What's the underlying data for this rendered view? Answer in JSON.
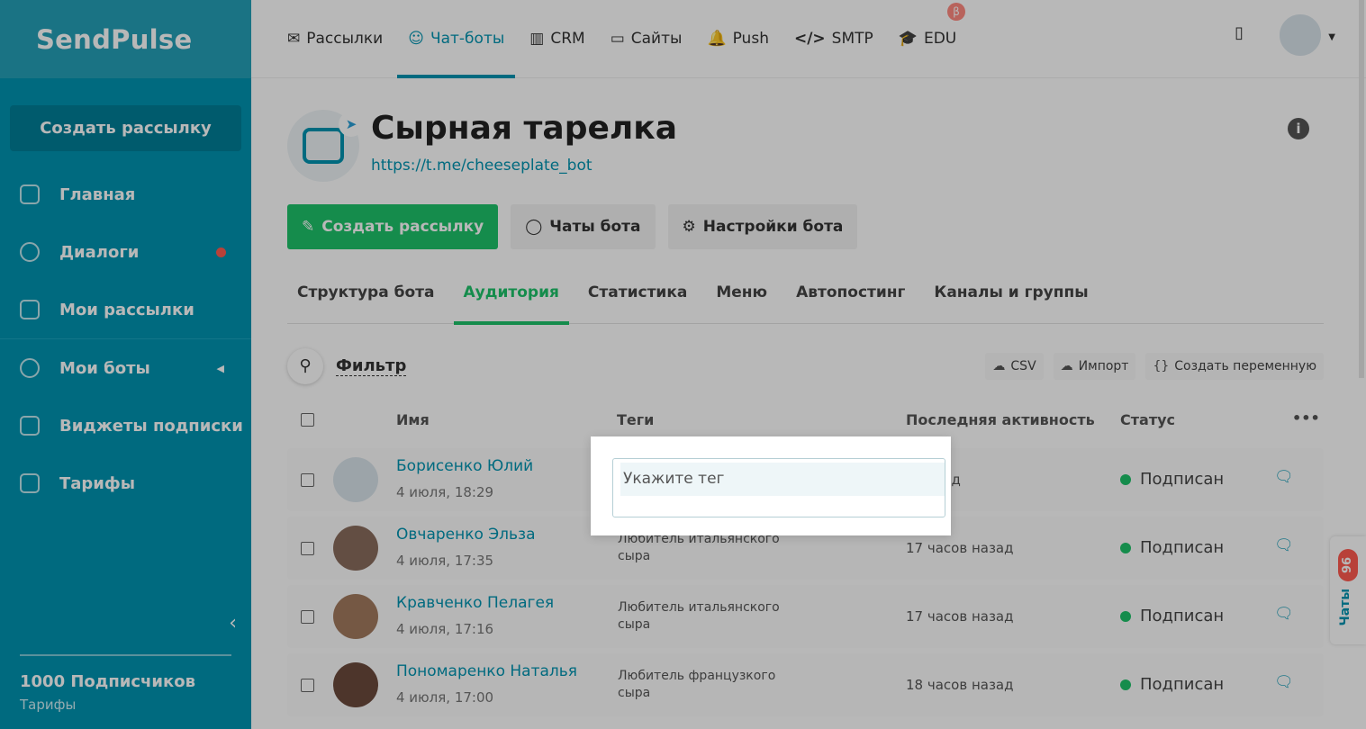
{
  "sidebar": {
    "logo": "SendPulse",
    "create_button": "Создать рассылку",
    "items": [
      {
        "label": "Главная"
      },
      {
        "label": "Диалоги"
      },
      {
        "label": "Мои рассылки"
      },
      {
        "label": "Мои боты"
      },
      {
        "label": "Виджеты подписки"
      },
      {
        "label": "Тарифы"
      }
    ],
    "footer_title": "1000 Подписчиков",
    "footer_link": "Тарифы"
  },
  "topnav": {
    "items": [
      {
        "label": "Рассылки",
        "icon": "✉"
      },
      {
        "label": "Чат-боты",
        "icon": "☺"
      },
      {
        "label": "CRM",
        "icon": "▥"
      },
      {
        "label": "Сайты",
        "icon": "▭"
      },
      {
        "label": "Push",
        "icon": "🔔"
      },
      {
        "label": "SMTP",
        "icon": "</>"
      },
      {
        "label": "EDU",
        "icon": "🎓"
      }
    ],
    "beta": "β"
  },
  "bot": {
    "title": "Сырная тарелка",
    "link": "https://t.me/cheeseplate_bot"
  },
  "buttons": {
    "create": "Создать рассылку",
    "chats": "Чаты бота",
    "settings": "Настройки бота"
  },
  "tabs": [
    "Структура бота",
    "Аудитория",
    "Статистика",
    "Меню",
    "Автопостинг",
    "Каналы и группы"
  ],
  "filter": {
    "label": "Фильтр",
    "csv": "CSV",
    "import": "Импорт",
    "create_var": "Создать переменную"
  },
  "table": {
    "headers": {
      "name": "Имя",
      "tags": "Теги",
      "last": "Последняя активность",
      "status": "Статус",
      "more": "•••"
    },
    "rows": [
      {
        "name": "Борисенко Юлий",
        "date": "4 июля, 18:29",
        "tags": "",
        "last": "3 назад",
        "status": "Подписан"
      },
      {
        "name": "Овчаренко Эльза",
        "date": "4 июля, 17:35",
        "tags": "Любитель итальянского сыра",
        "last": "17 часов назад",
        "status": "Подписан"
      },
      {
        "name": "Кравченко Пелагея",
        "date": "4 июля, 17:16",
        "tags": "Любитель итальянского сыра",
        "last": "17 часов назад",
        "status": "Подписан"
      },
      {
        "name": "Пономаренко Наталья",
        "date": "4 июля, 17:00",
        "tags": "Любитель французкого сыра",
        "last": "18 часов назад",
        "status": "Подписан"
      }
    ]
  },
  "chats_tab": {
    "label": "Чаты",
    "count": "96"
  },
  "popup": {
    "placeholder": "Укажите тег"
  }
}
